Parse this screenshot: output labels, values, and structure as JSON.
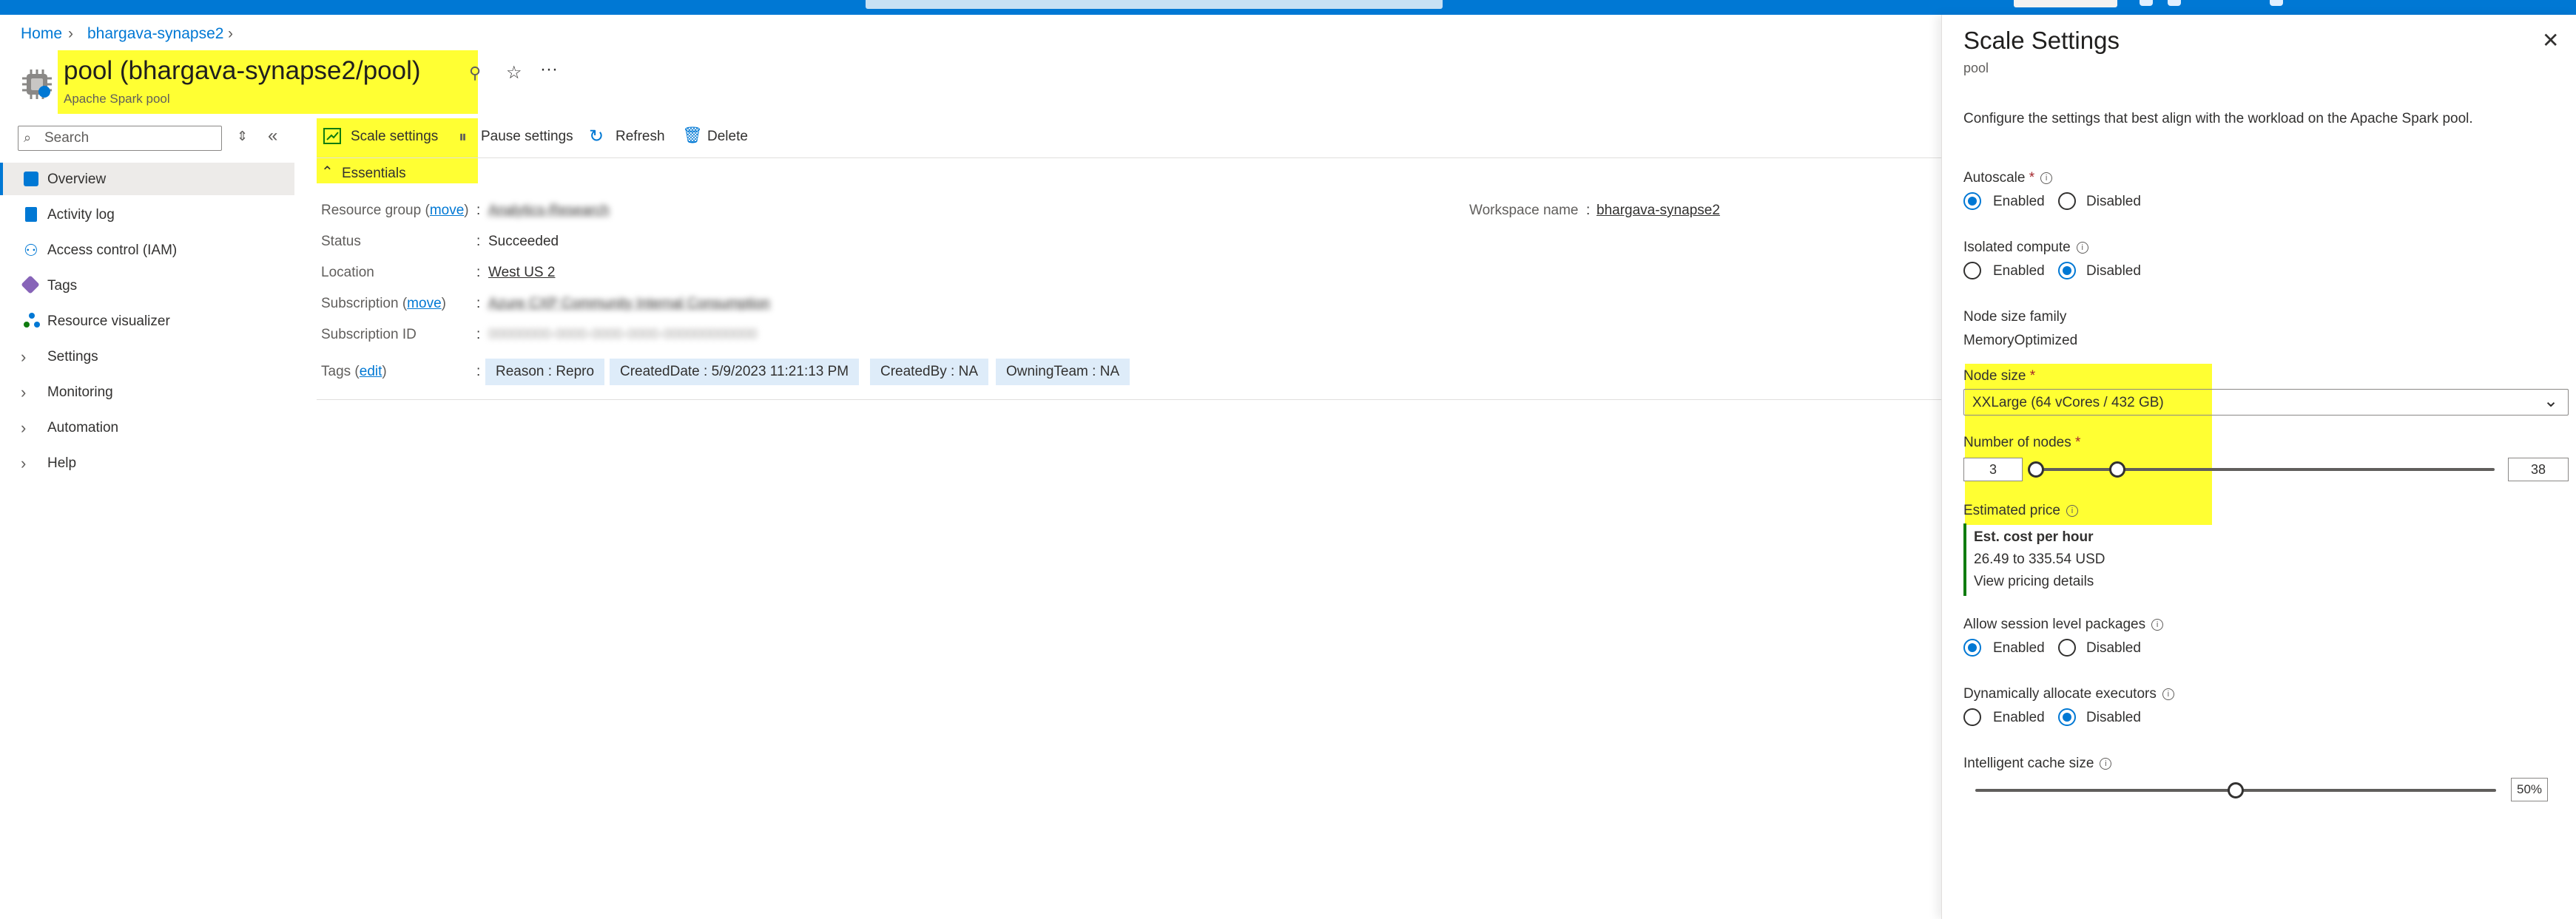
{
  "breadcrumb": {
    "home": "Home",
    "workspace": "bhargava-synapse2"
  },
  "header": {
    "title": "pool (bhargava-synapse2/pool)",
    "subtitle": "Apache Spark pool"
  },
  "sidebar": {
    "search_placeholder": "Search",
    "items": [
      {
        "label": "Overview",
        "icon": "overview-icon"
      },
      {
        "label": "Activity log",
        "icon": "activity-log-icon"
      },
      {
        "label": "Access control (IAM)",
        "icon": "iam-icon"
      },
      {
        "label": "Tags",
        "icon": "tag-icon"
      },
      {
        "label": "Resource visualizer",
        "icon": "visualizer-icon"
      },
      {
        "label": "Settings",
        "icon": "chevron-right-icon"
      },
      {
        "label": "Monitoring",
        "icon": "chevron-right-icon"
      },
      {
        "label": "Automation",
        "icon": "chevron-right-icon"
      },
      {
        "label": "Help",
        "icon": "chevron-right-icon"
      }
    ]
  },
  "commandbar": {
    "scale": "Scale settings",
    "pause": "Pause settings",
    "refresh": "Refresh",
    "delete": "Delete"
  },
  "essentials": {
    "heading": "Essentials",
    "resource_group_label": "Resource group",
    "move": "move",
    "resource_group_value": "Analytics-Research",
    "status_label": "Status",
    "status_value": "Succeeded",
    "location_label": "Location",
    "location_value": "West US 2",
    "subscription_label": "Subscription",
    "subscription_value": "Azure CXP Community Internal Consumption",
    "subscription_id_label": "Subscription ID",
    "subscription_id_value": "00000000-0000-0000-0000-000000000000",
    "tags_label": "Tags",
    "edit": "edit",
    "workspace_label": "Workspace name",
    "workspace_value": "bhargava-synapse2",
    "tags": [
      "Reason : Repro",
      "CreatedDate : 5/9/2023 11:21:13 PM",
      "CreatedBy : NA",
      "OwningTeam : NA"
    ]
  },
  "panel": {
    "title": "Scale Settings",
    "subtitle": "pool",
    "description": "Configure the settings that best align with the workload on the Apache Spark pool.",
    "enabled": "Enabled",
    "disabled": "Disabled",
    "autoscale": {
      "label": "Autoscale",
      "value": "Enabled"
    },
    "isolated": {
      "label": "Isolated compute",
      "value": "Disabled"
    },
    "node_family": {
      "label": "Node size family",
      "value": "MemoryOptimized"
    },
    "node_size": {
      "label": "Node size",
      "value": "XXLarge (64 vCores / 432 GB)"
    },
    "nodes": {
      "label": "Number of nodes",
      "min": "3",
      "max": "38",
      "slider_range": [
        3,
        200
      ]
    },
    "price": {
      "label": "Estimated price",
      "heading": "Est. cost per hour",
      "range": "26.49 to 335.54 USD",
      "link": "View pricing details"
    },
    "session_packages": {
      "label": "Allow session level packages",
      "value": "Enabled"
    },
    "dynamic_executors": {
      "label": "Dynamically allocate executors",
      "value": "Disabled"
    },
    "cache": {
      "label": "Intelligent cache size",
      "value": "50%",
      "fraction": 0.5
    }
  },
  "colors": {
    "accent": "#0078d4",
    "highlight": "#ffff33",
    "price_bar": "#107c10"
  }
}
